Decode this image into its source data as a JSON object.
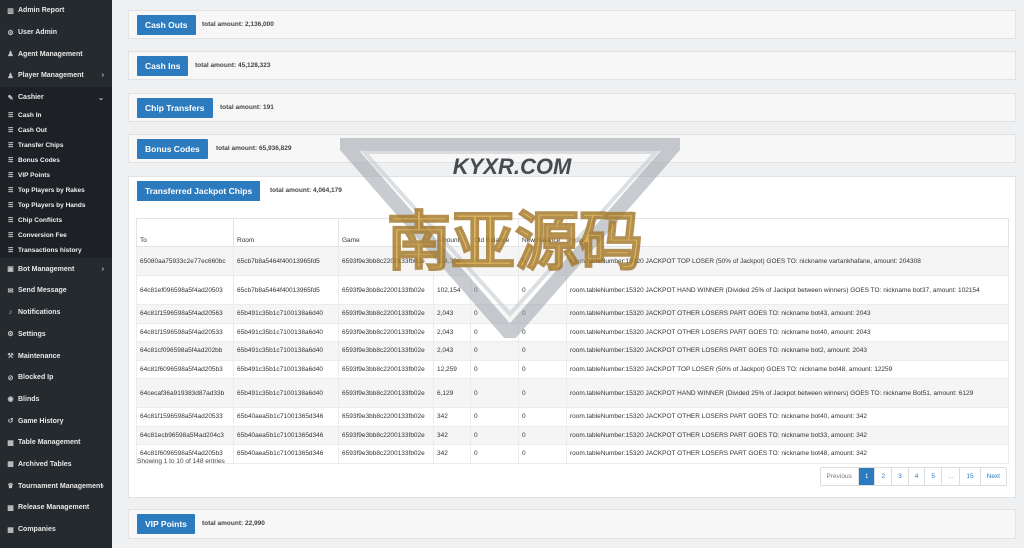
{
  "sidebar": {
    "items": [
      {
        "icon": "chart-icon",
        "glyph": "▥",
        "label": "Admin Report"
      },
      {
        "icon": "user-icon",
        "glyph": "⚙",
        "label": "User Admin"
      },
      {
        "icon": "user-tie-icon",
        "glyph": "♟",
        "label": "Agent Management"
      },
      {
        "icon": "users-icon",
        "glyph": "♟",
        "label": "Player Management",
        "chevron": "›"
      },
      {
        "icon": "cashier-icon",
        "glyph": "✎",
        "label": "Cashier",
        "chevron": "⌄"
      }
    ],
    "cashier_sub": [
      "Cash In",
      "Cash Out",
      "Transfer Chips",
      "Bonus Codes",
      "VIP Points",
      "Top Players by Rakes",
      "Top Players by Hands",
      "Chip Conflicts",
      "Conversion Fee",
      "Transactions history"
    ],
    "items_after": [
      {
        "icon": "bot-icon",
        "glyph": "▣",
        "label": "Bot Management",
        "chevron": "›"
      },
      {
        "icon": "envelope-icon",
        "glyph": "✉",
        "label": "Send Message"
      },
      {
        "icon": "bell-icon",
        "glyph": "♪",
        "label": "Notifications"
      },
      {
        "icon": "gear-icon",
        "glyph": "⚙",
        "label": "Settings"
      },
      {
        "icon": "wrench-icon",
        "glyph": "⚒",
        "label": "Maintenance"
      },
      {
        "icon": "ban-icon",
        "glyph": "⊘",
        "label": "Blocked Ip"
      },
      {
        "icon": "blinds-icon",
        "glyph": "◉",
        "label": "Blinds"
      },
      {
        "icon": "history-icon",
        "glyph": "↺",
        "label": "Game History"
      },
      {
        "icon": "table-icon",
        "glyph": "▦",
        "label": "Table Management"
      },
      {
        "icon": "archive-icon",
        "glyph": "▦",
        "label": "Archived Tables"
      },
      {
        "icon": "trophy-icon",
        "glyph": "♛",
        "label": "Tournament Management",
        "chevron": "›"
      },
      {
        "icon": "release-icon",
        "glyph": "▦",
        "label": "Release Management"
      },
      {
        "icon": "building-icon",
        "glyph": "▦",
        "label": "Companies"
      }
    ]
  },
  "panels": {
    "cash_outs": {
      "label": "Cash Outs",
      "total": "total amount: 2,136,000"
    },
    "cash_ins": {
      "label": "Cash Ins",
      "total": "total amount: 45,128,323"
    },
    "chip_transfers": {
      "label": "Chip Transfers",
      "total": "total amount: 191"
    },
    "bonus_codes": {
      "label": "Bonus Codes",
      "total": "total amount: 65,936,829"
    },
    "jackpot": {
      "label": "Transferred Jackpot Chips",
      "total": "total amount: 4,064,179"
    },
    "vip_points": {
      "label": "VIP Points",
      "total": "total amount: 22,990"
    }
  },
  "table": {
    "headers": [
      "To",
      "Room",
      "Game",
      "Amount",
      "Old Balance",
      "New Balance",
      "Note"
    ],
    "rows": [
      [
        "65080aa75933c2e77ec660bc",
        "65cb7b8a5464f40013965fd5",
        "6593f9e3bb8c2200133fb02e",
        "204,308",
        "0",
        "0",
        "room.tableNumber:15320 JACKPOT TOP LOSER (50% of Jackpot) GOES TO: nickname vartankhafane, amount: 204308"
      ],
      [
        "64c81ef096598a5f4ad20503",
        "65cb7b8a5464f40013965fd5",
        "6593f9e3bb8c2200133fb02e",
        "102,154",
        "0",
        "0",
        "room.tableNumber:15320 JACKPOT HAND WINNER (Divided 25% of Jackpot between winners) GOES TO: nickname bot37, amount: 102154"
      ],
      [
        "64c81f1596598a5f4ad20563",
        "65b491c35b1c7100138a6d40",
        "6593f9e3bb8c2200133fb02e",
        "2,043",
        "0",
        "0",
        "room.tableNumber:15320 JACKPOT OTHER LOSERS PART GOES TO: nickname bot43, amount: 2043"
      ],
      [
        "64c81f1596598a5f4ad20533",
        "65b491c35b1c7100138a6d40",
        "6593f9e3bb8c2200133fb02e",
        "2,043",
        "0",
        "0",
        "room.tableNumber:15320 JACKPOT OTHER LOSERS PART GOES TO: nickname bot40, amount: 2043"
      ],
      [
        "64c81cf096598a5f4ad202bb",
        "65b491c35b1c7100138a6d40",
        "6593f9e3bb8c2200133fb02e",
        "2,043",
        "0",
        "0",
        "room.tableNumber:15320 JACKPOT OTHER LOSERS PART GOES TO: nickname bot2, amount: 2043"
      ],
      [
        "64c81f6096598a5f4ad205b3",
        "65b491c35b1c7100138a6d40",
        "6593f9e3bb8c2200133fb02e",
        "12,259",
        "0",
        "0",
        "room.tableNumber:15320 JACKPOT TOP LOSER (50% of Jackpot) GOES TO: nickname bot48, amount: 12259"
      ],
      [
        "64cecaf36a919383d87ad33b",
        "65b491c35b1c7100138a6d40",
        "6593f9e3bb8c2200133fb02e",
        "6,129",
        "0",
        "0",
        "room.tableNumber:15320 JACKPOT HAND WINNER (Divided 25% of Jackpot between winners) GOES TO: nickname Bot51, amount: 6129"
      ],
      [
        "64c81f1596598a5f4ad20533",
        "65b40aea5b1c71001365d346",
        "6593f9e3bb8c2200133fb02e",
        "342",
        "0",
        "0",
        "room.tableNumber:15320 JACKPOT OTHER LOSERS PART GOES TO: nickname bot40, amount: 342"
      ],
      [
        "64c81ecb96598a5f4ad204c3",
        "65b40aea5b1c71001365d346",
        "6593f9e3bb8c2200133fb02e",
        "342",
        "0",
        "0",
        "room.tableNumber:15320 JACKPOT OTHER LOSERS PART GOES TO: nickname bot33, amount: 342"
      ],
      [
        "64c81f6096598a5f4ad205b3",
        "65b40aea5b1c71001365d346",
        "6593f9e3bb8c2200133fb02e",
        "342",
        "0",
        "0",
        "room.tableNumber:15320 JACKPOT OTHER LOSERS PART GOES TO: nickname bot48, amount: 342"
      ]
    ],
    "showing": "Showing 1 to 10 of 148 entries"
  },
  "pagination": [
    "Previous",
    "1",
    "2",
    "3",
    "4",
    "5",
    "...",
    "15",
    "Next"
  ],
  "watermark": {
    "top_text": "KYXR.COM",
    "main_text": "南亚源码"
  },
  "colors": {
    "accent": "#2c7bbf",
    "sidebar": "#252a2e",
    "watermark_gold": "#d9a93a"
  }
}
